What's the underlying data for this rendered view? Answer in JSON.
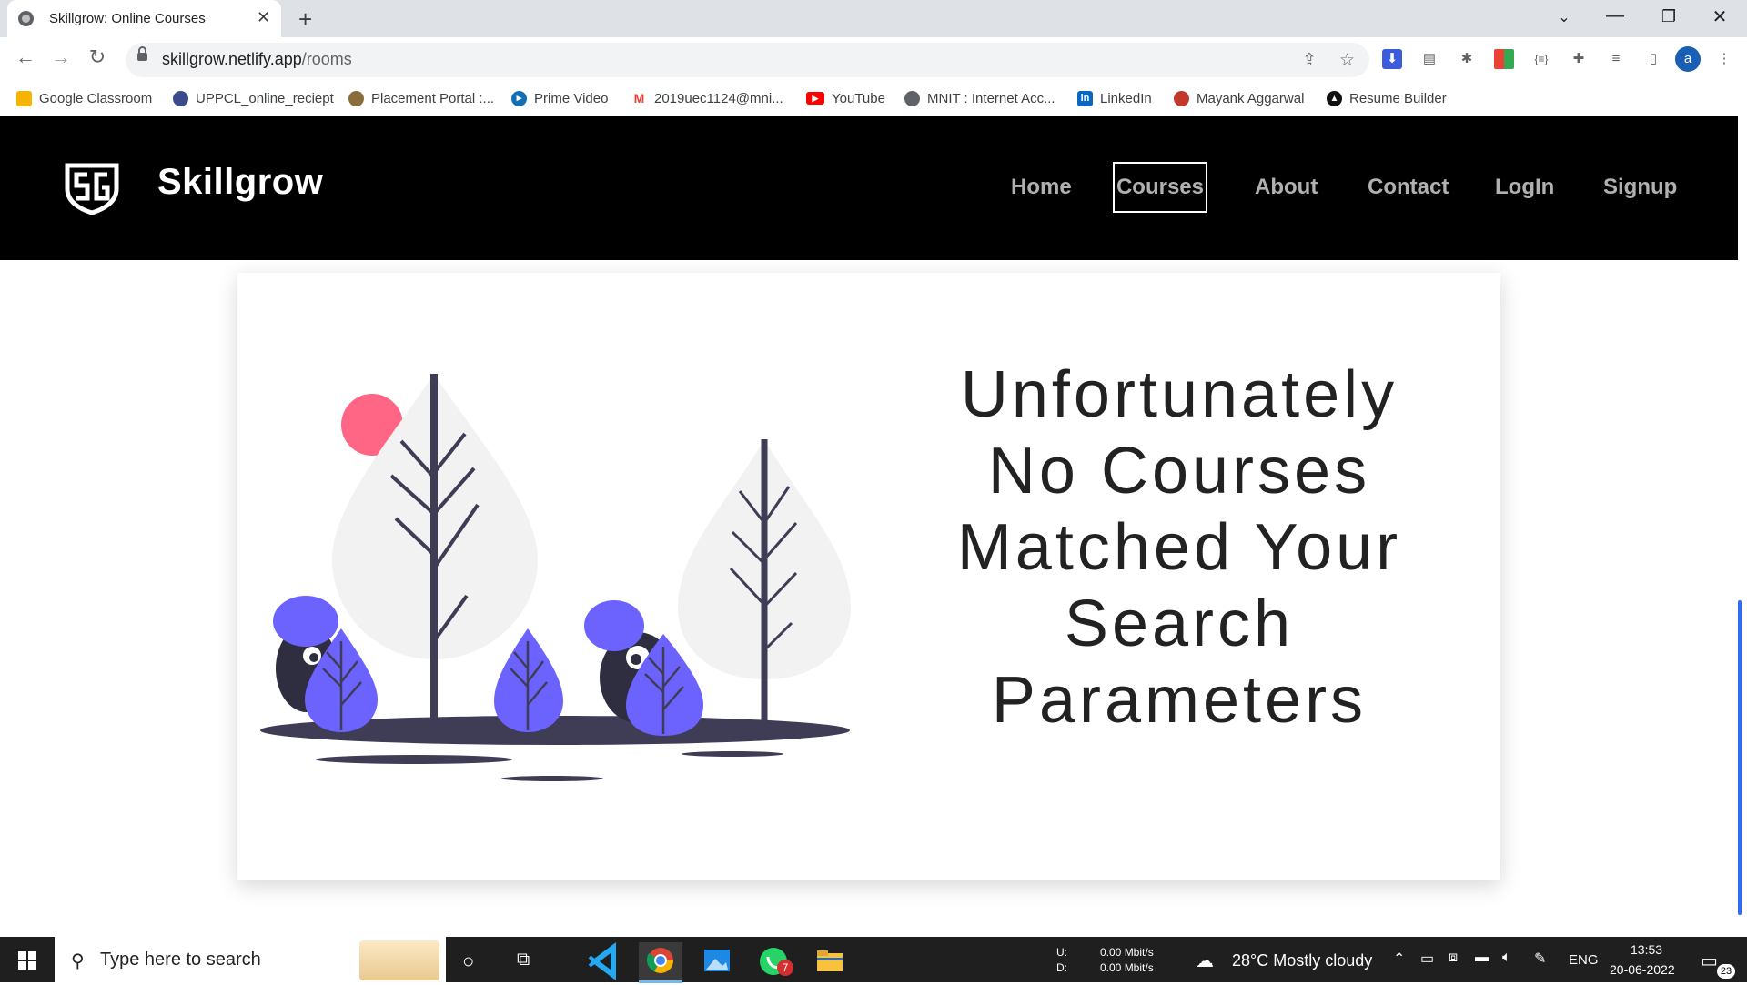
{
  "browser": {
    "tab_title": "Skillgrow: Online Courses",
    "url_host": "skillgrow.netlify.app",
    "url_path": "/rooms",
    "profile_initial": "a",
    "bookmarks": [
      {
        "label": "Google Classroom",
        "color": "#f4b400"
      },
      {
        "label": "UPPCL_online_reciept",
        "color": "#3b4a8c"
      },
      {
        "label": "Placement Portal :...",
        "color": "#8a6d3b"
      },
      {
        "label": "Prime Video",
        "color": "#146eb4"
      },
      {
        "label": "2019uec1124@mni...",
        "color": "#ea4335"
      },
      {
        "label": "YouTube",
        "color": "#ff0000"
      },
      {
        "label": "MNIT : Internet Acc...",
        "color": "#5f6368"
      },
      {
        "label": "LinkedIn",
        "color": "#0a66c2"
      },
      {
        "label": "Mayank Aggarwal",
        "color": "#c0392b"
      },
      {
        "label": "Resume Builder",
        "color": "#111111"
      }
    ]
  },
  "site": {
    "brand": "Skillgrow",
    "nav": {
      "home": "Home",
      "courses": "Courses",
      "about": "About",
      "contact": "Contact",
      "login": "LogIn",
      "signup": "Signup"
    },
    "message_lines": [
      "Unfortunately",
      "No Courses",
      "Matched Your",
      "Search",
      "Parameters"
    ],
    "colors": {
      "header": "#000000",
      "accent_purple": "#6c63ff",
      "sun": "#ff6584",
      "dark": "#3f3d56",
      "leaf_light": "#f2f2f2"
    }
  },
  "taskbar": {
    "search_placeholder": "Type here to search",
    "net_upload_label": "U:",
    "net_download_label": "D:",
    "net_upload": "0.00 Mbit/s",
    "net_download": "0.00 Mbit/s",
    "weather": "28°C  Mostly cloudy",
    "language": "ENG",
    "time": "13:53",
    "date": "20-06-2022",
    "notification_count": "23",
    "whatsapp_badge": "7"
  }
}
